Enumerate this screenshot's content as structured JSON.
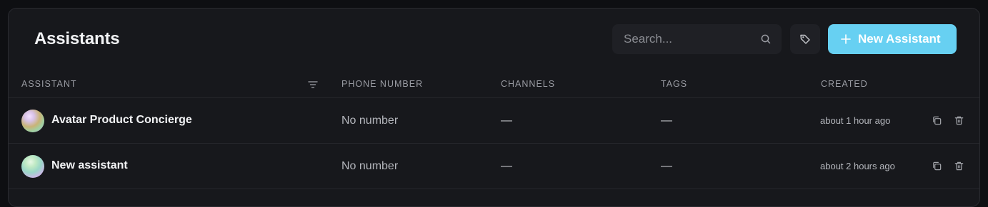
{
  "header": {
    "title": "Assistants",
    "search_placeholder": "Search...",
    "new_button_label": "New Assistant"
  },
  "table": {
    "columns": [
      "ASSISTANT",
      "PHONE NUMBER",
      "CHANNELS",
      "TAGS",
      "CREATED"
    ],
    "rows": [
      {
        "name": "Avatar Product Concierge",
        "phone": "No number",
        "channels": "—",
        "tags": "—",
        "created": "about 1 hour ago"
      },
      {
        "name": "New assistant",
        "phone": "No number",
        "channels": "—",
        "tags": "—",
        "created": "about 2 hours ago"
      }
    ]
  },
  "icons": {
    "search": "search-icon",
    "tag": "tag-icon",
    "plus": "plus-icon",
    "filter": "filter-icon",
    "copy": "copy-icon",
    "trash": "trash-icon"
  },
  "colors": {
    "accent": "#67d0f2",
    "panel": "#17181c",
    "background": "#0e0f12"
  }
}
